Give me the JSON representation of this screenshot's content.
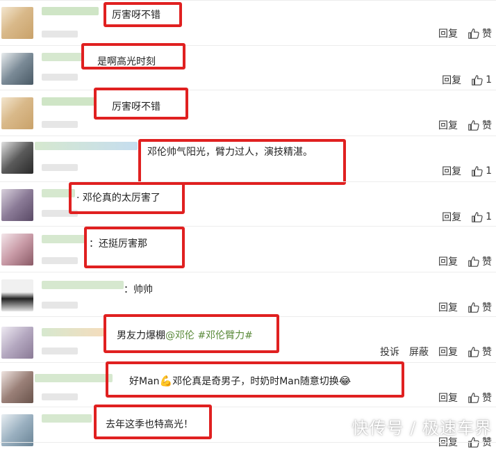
{
  "comments": [
    {
      "text": "厉害呀不错",
      "like_label": "赞",
      "reply_label": "回复",
      "extra": []
    },
    {
      "text": "是啊高光时刻",
      "like_label": "1",
      "reply_label": "回复",
      "extra": []
    },
    {
      "text": "厉害呀不错",
      "like_label": "赞",
      "reply_label": "回复",
      "extra": []
    },
    {
      "text": "邓伦帅气阳光，臂力过人，演技精湛。",
      "like_label": "1",
      "reply_label": "回复",
      "extra": []
    },
    {
      "text": "邓伦真的太厉害了",
      "prefix": "·",
      "like_label": "1",
      "reply_label": "回复",
      "extra": []
    },
    {
      "text": "还挺厉害那",
      "prefix": "：",
      "like_label": "赞",
      "reply_label": "回复",
      "extra": []
    },
    {
      "text": "帅帅",
      "prefix": "：",
      "like_label": "赞",
      "reply_label": "回复",
      "extra": []
    },
    {
      "text": "男友力爆棚",
      "mention": "@邓伦",
      "hashtag": "#邓伦臂力#",
      "like_label": "赞",
      "reply_label": "回复",
      "extra": [
        "投诉",
        "屏蔽"
      ]
    },
    {
      "text_a": "好Man",
      "text_b": "邓伦真是奇男子，时奶时Man随意切换",
      "like_label": "赞",
      "reply_label": "回复",
      "extra": []
    },
    {
      "text": "去年这季也特高光！",
      "like_label": "赞",
      "reply_label": "回复",
      "extra": []
    }
  ],
  "watermark": "快传号 / 极速车界",
  "colors": {
    "highlight_box": "#e02020",
    "tag": "#5a8a3a",
    "divider": "#ececec"
  }
}
